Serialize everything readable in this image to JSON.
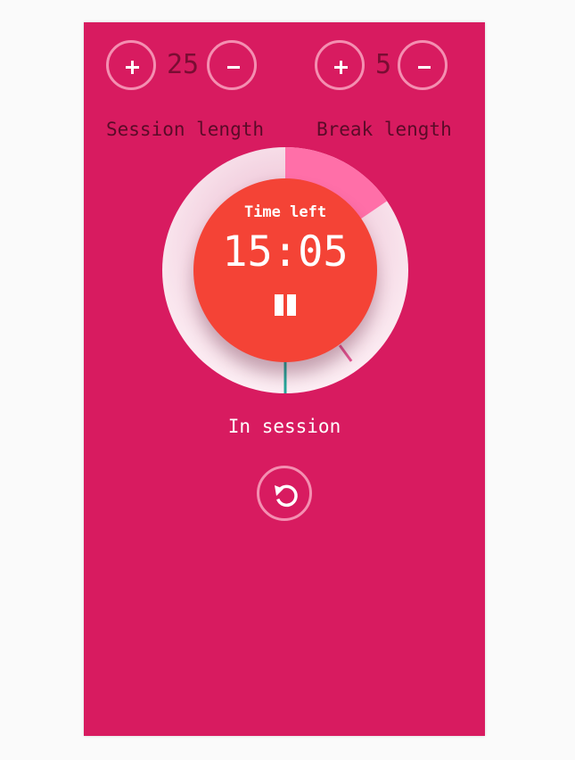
{
  "session": {
    "increment_symbol": "+",
    "decrement_symbol": "−",
    "value": "25",
    "label": "Session length"
  },
  "break": {
    "increment_symbol": "+",
    "decrement_symbol": "−",
    "value": "5",
    "label": "Break length"
  },
  "timer": {
    "title": "Time left",
    "time": "15:05",
    "status": "In session",
    "elapsed_fraction": 0.4
  },
  "icons": {
    "plus": "plus-icon",
    "minus": "minus-icon",
    "pause": "pause-icon",
    "reset": "reset-icon"
  },
  "colors": {
    "background": "#d81b60",
    "face": "#f44336",
    "ring_track": "#fce4ec",
    "ring_highlight": "#ff6fa8",
    "button_border": "#f48fb1",
    "count_text": "#7a0d33",
    "label_text": "#5a0b28",
    "start_marker": "#26a69a"
  }
}
